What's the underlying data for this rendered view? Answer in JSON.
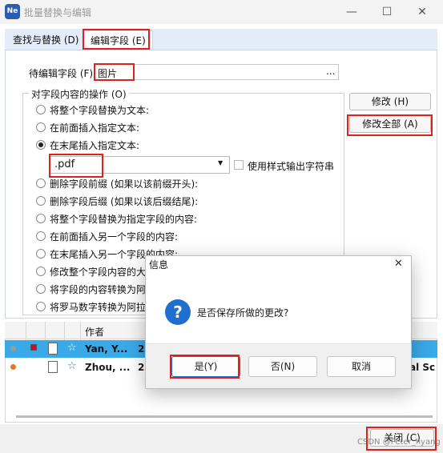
{
  "window": {
    "title": "批量替换与编辑",
    "app_icon_text": "Ne",
    "minimize_glyph": "—",
    "maximize_glyph": "☐",
    "close_glyph": "✕"
  },
  "tabs": [
    {
      "label": "查找与替换 (D)",
      "active": false
    },
    {
      "label": "编辑字段 (E)",
      "active": true
    }
  ],
  "field_to_edit": {
    "label": "待编辑字段 (F):",
    "value": "图片",
    "browse_label": "..."
  },
  "operations": {
    "group_title": "对字段内容的操作 (O)",
    "options": [
      {
        "label": "将整个字段替换为文本:",
        "checked": false
      },
      {
        "label": "在前面插入指定文本:",
        "checked": false
      },
      {
        "label": "在末尾插入指定文本:",
        "checked": true
      },
      {
        "label": "删除字段前缀 (如果以该前缀开头):",
        "checked": false
      },
      {
        "label": "删除字段后缀 (如果以该后缀结尾):",
        "checked": false
      },
      {
        "label": "将整个字段替换为指定字段的内容:",
        "checked": false
      },
      {
        "label": "在前面插入另一个字段的内容:",
        "checked": false
      },
      {
        "label": "在末尾插入另一个字段的内容:",
        "checked": false
      },
      {
        "label": "修改整个字段内容的大",
        "checked": false
      },
      {
        "label": "将字段的内容转换为阿",
        "checked": false
      },
      {
        "label": "将罗马数字转换为阿拉",
        "checked": false
      }
    ],
    "text_value": ".pdf",
    "use_style_label": "使用样式输出字符串",
    "use_style_checked": false
  },
  "side_buttons": {
    "modify": "修改 (H)",
    "modify_all": "修改全部 (A)"
  },
  "list": {
    "header_author": "作者",
    "rows": [
      {
        "author": "Yan, Y...",
        "extra": "2",
        "selected": true,
        "dot_color": "#9a9a9a"
      },
      {
        "author": "Zhou, ...",
        "extra": "2",
        "selected": false,
        "dot_color": "#e87722",
        "trailing": "al Sc"
      }
    ]
  },
  "dialog": {
    "title": "信息",
    "message": "是否保存所做的更改?",
    "icon_glyph": "?",
    "yes": "是(Y)",
    "no": "否(N)",
    "cancel": "取消",
    "close_glyph": "✕"
  },
  "close_button": "关闭 (C)",
  "watermark": "CSDN @Peter_hyang"
}
